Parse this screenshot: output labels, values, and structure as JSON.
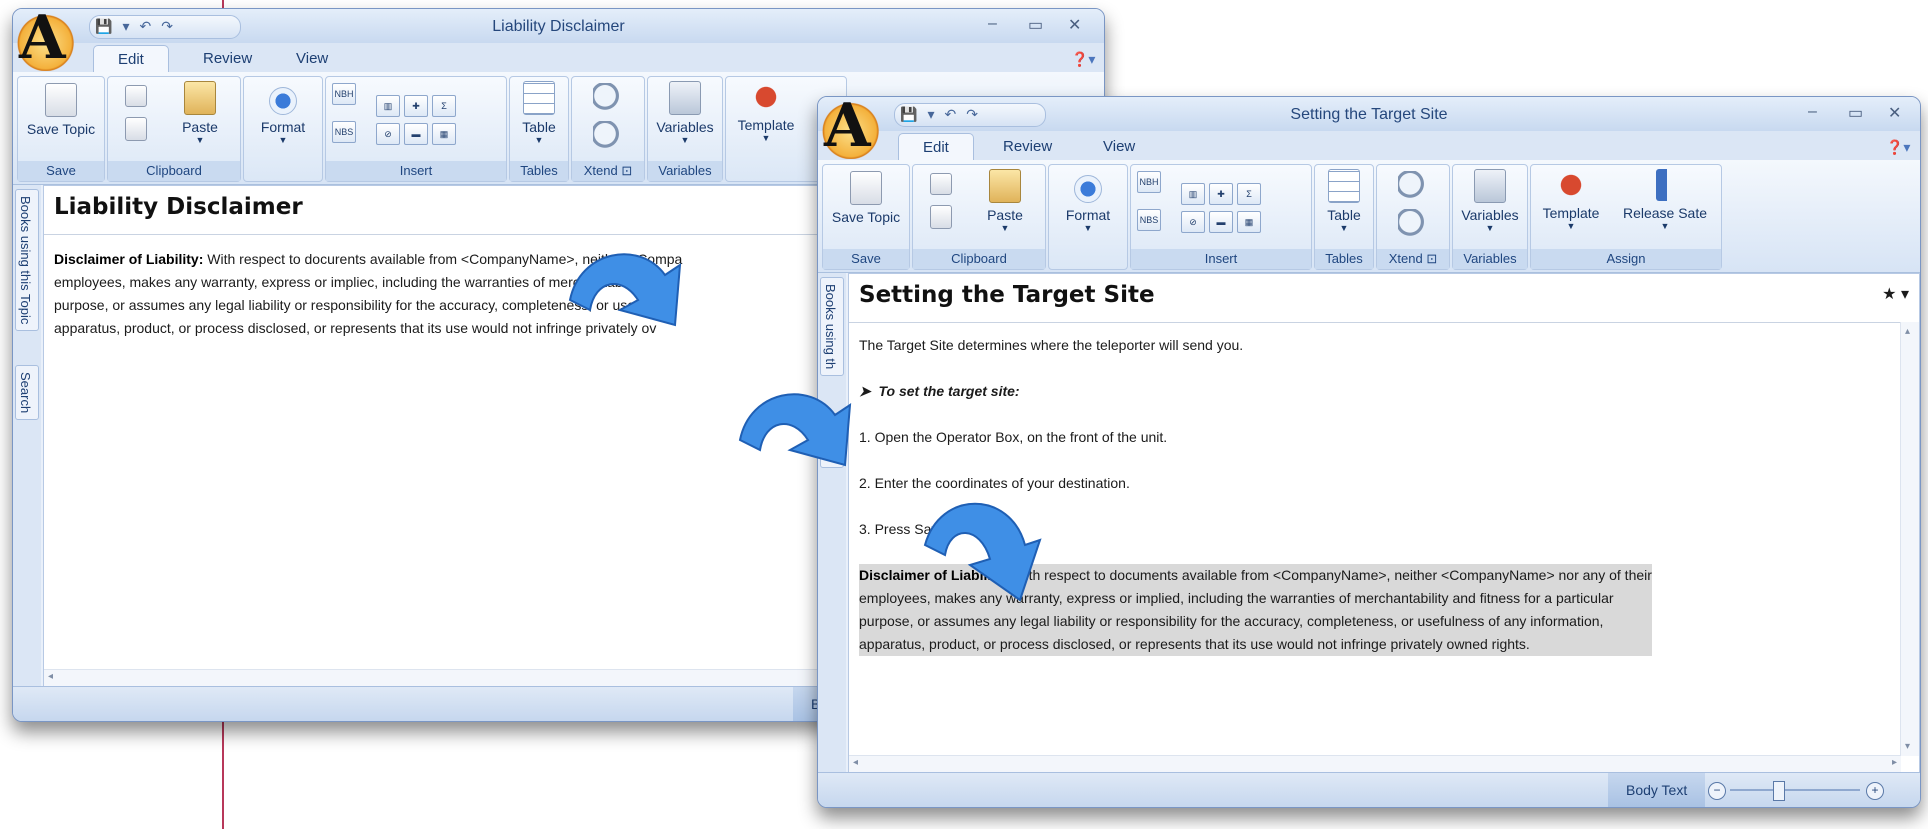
{
  "app": {
    "logo_letter": "A",
    "quick_access": [
      "💾",
      "▾",
      "↶",
      "↷"
    ],
    "window_controls": [
      "–",
      "▭",
      "✕"
    ]
  },
  "ribbon": {
    "tabs": [
      "Edit",
      "Review",
      "View"
    ],
    "groups": {
      "save": {
        "label": "Save",
        "save_topic": "Save Topic"
      },
      "clipboard": {
        "label": "Clipboard",
        "paste": "Paste"
      },
      "format": {
        "format": "Format"
      },
      "insert": {
        "label": "Insert",
        "nbh": "NBH",
        "nbs": "NBS",
        "sigma": "Σ"
      },
      "tables": {
        "label": "Tables",
        "table": "Table"
      },
      "xtend": {
        "label": "Xtend"
      },
      "variables": {
        "label": "Variables",
        "variables": "Variables"
      },
      "assign": {
        "label": "Assign",
        "template": "Template",
        "release_state": "Release Sate"
      }
    }
  },
  "side_tabs": {
    "books_full": "Books using this Topic",
    "books_short": "Books using th",
    "search": "Search"
  },
  "window_back": {
    "title": "Liability Disclaimer",
    "doc_title": "Liability Disclaimer",
    "para_bold": "Disclaimer of Liability:",
    "para_lines": [
      "With respect to docurents available from <CompanyName>, neither <Compa",
      "employees, makes any warranty, express or impliec, including the warranties of merchantability a",
      "purpose, or assumes any legal liability or responsibility for the accuracy, completeness, or usefu",
      "apparatus, product, or process disclosed, or represents that its use would not infringe privately ov"
    ],
    "status_text": "Bo"
  },
  "window_front": {
    "title": "Setting the Target Site",
    "doc_title": "Setting the Target Site",
    "star": "★",
    "intro": "The Target Site determines where the teleporter will send you.",
    "procedure": "To set the target site:",
    "steps": [
      "1. Open the Operator Box, on the front of the unit.",
      "2. Enter the coordinates of your destination.",
      "3. Press Save."
    ],
    "para_bold": "Disclaimer of Liability:",
    "para_lines": [
      "With respect to documents available from <CompanyName>, neither <CompanyName> nor any of their",
      "employees, makes any warranty, express or implied, including the warranties of merchantability and fitness for a particular",
      "purpose, or assumes any legal liability or responsibility for the accuracy, completeness, or usefulness of any information,",
      "apparatus, product, or process disclosed, or represents that its use would not infringe privately owned rights."
    ],
    "status_style": "Body Text",
    "zoom_out": "−",
    "zoom_in": "+"
  },
  "colors": {
    "accent": "#1d3f73",
    "arrow": "#3f8fe6",
    "selection": "#d9d9d9"
  }
}
